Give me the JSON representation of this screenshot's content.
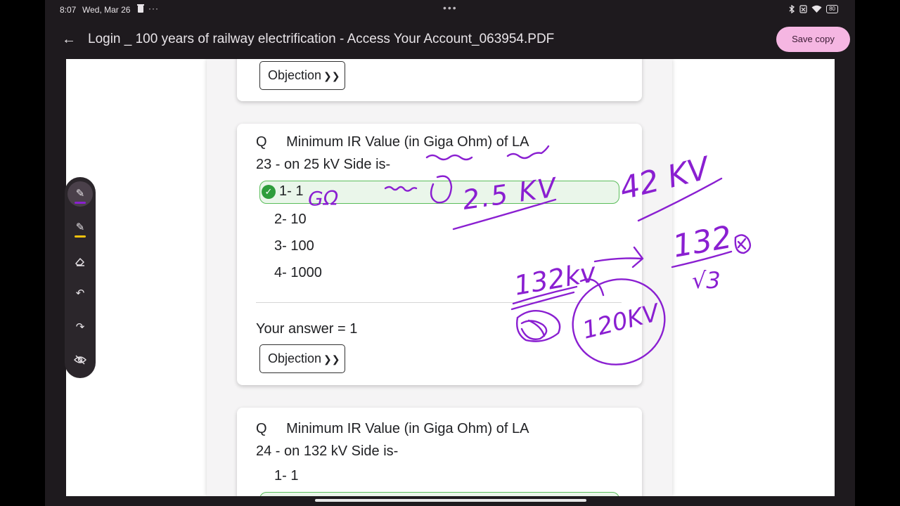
{
  "status_bar": {
    "time": "8:07",
    "date": "Wed, Mar 26",
    "more": "···",
    "center_dots": "•••",
    "battery": "80",
    "icons": [
      "bluetooth-icon",
      "no-sim-icon",
      "wifi-icon",
      "battery-icon"
    ]
  },
  "app_bar": {
    "back_icon": "←",
    "title": "Login _ 100 years of railway electrification - Access Your Account_063954.PDF",
    "save_copy": "Save copy"
  },
  "cards": {
    "card22": {
      "objection": "Objection"
    },
    "card23": {
      "q_label": "Q",
      "q_text_line1": "Minimum IR Value (in Giga Ohm) of LA",
      "q_num": "23 - on 25 kV Side is-",
      "correct_option": "1- 1",
      "options": [
        "2- 10",
        "3- 100",
        "4- 1000"
      ],
      "your_answer": "Your answer = 1",
      "objection": "Objection"
    },
    "card24": {
      "q_label": "Q",
      "q_text_line1": "Minimum IR Value (in Giga Ohm) of LA",
      "q_num": "24 - on 132 kV Side is-",
      "option1": "1- 1"
    }
  },
  "handwriting": {
    "g_ohm": "GΩ",
    "at_sign": "@",
    "v1": "2.5 KV",
    "v2": "42 KV",
    "v3": "132",
    "sqrt3": "√3",
    "v4": "132kv",
    "v5": "120KV"
  },
  "colors": {
    "accent_pink": "#f5b6e2",
    "ink_purple": "#8a1fd1",
    "correct_green": "#5bbd5b",
    "toolbar_bg": "#2b262b"
  }
}
